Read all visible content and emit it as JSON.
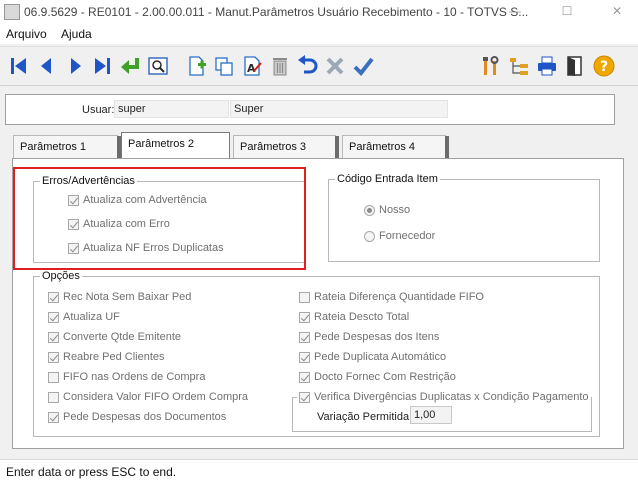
{
  "window": {
    "title": "06.9.5629 - RE0101 - 2.00.00.011 - Manut.Parâmetros Usuário Recebimento - 10 - TOTVS S...",
    "minimize_glyph": "—",
    "maximize_glyph": "☐",
    "close_glyph": "✕"
  },
  "menu": {
    "items": [
      "Arquivo",
      "Ajuda"
    ]
  },
  "toolbar": {
    "icons": [
      "first-record-icon",
      "previous-record-icon",
      "next-record-icon",
      "last-record-icon",
      "goto-icon",
      "search-icon",
      "new-record-icon",
      "copy-record-icon",
      "edit-record-icon",
      "delete-record-icon",
      "undo-icon",
      "cancel-icon",
      "save-icon",
      "tools-icon",
      "tree-icon",
      "print-icon",
      "exit-icon",
      "help-icon"
    ]
  },
  "user": {
    "label": "Usuar:",
    "code": "super",
    "name": "Super"
  },
  "tabs": [
    "Parâmetros 1",
    "Parâmetros 2",
    "Parâmetros 3",
    "Parâmetros 4"
  ],
  "active_tab": "Parâmetros 2",
  "erros": {
    "title": "Erros/Advertências",
    "items": [
      {
        "label": "Atualiza com Advertência",
        "checked": true
      },
      {
        "label": "Atualiza com Erro",
        "checked": true
      },
      {
        "label": "Atualiza NF Erros Duplicatas",
        "checked": true
      }
    ]
  },
  "codigo": {
    "title": "Código Entrada Item",
    "options": [
      {
        "label": "Nosso",
        "selected": true
      },
      {
        "label": "Fornecedor",
        "selected": false
      }
    ]
  },
  "opcoes": {
    "title": "Opções",
    "left": [
      {
        "label": "Rec Nota Sem Baixar Ped",
        "checked": true
      },
      {
        "label": "Atualiza UF",
        "checked": true
      },
      {
        "label": "Converte Qtde Emitente",
        "checked": true
      },
      {
        "label": "Reabre Ped Clientes",
        "checked": true
      },
      {
        "label": "FIFO nas Ordens de Compra",
        "checked": false
      },
      {
        "label": "Considera Valor FIFO Ordem Compra",
        "checked": false
      },
      {
        "label": "Pede Despesas dos Documentos",
        "checked": true
      }
    ],
    "right": [
      {
        "label": "Rateia Diferença Quantidade FIFO",
        "checked": false
      },
      {
        "label": "Rateia Descto Total",
        "checked": true
      },
      {
        "label": "Pede Despesas dos Itens",
        "checked": true
      },
      {
        "label": "Pede Duplicata Automático",
        "checked": true
      },
      {
        "label": "Docto Fornec Com Restrição",
        "checked": true
      }
    ],
    "verifica": {
      "label": "Verifica Divergências Duplicatas x Condição Pagamento",
      "checked": true
    },
    "variacao": {
      "label": "Variação Permitida:",
      "value": "1,00"
    }
  },
  "status": {
    "text": "Enter data or press ESC to end."
  },
  "colors": {
    "highlight": "#e02020",
    "nav_blue": "#1e56c8",
    "green": "#3fa02a"
  }
}
